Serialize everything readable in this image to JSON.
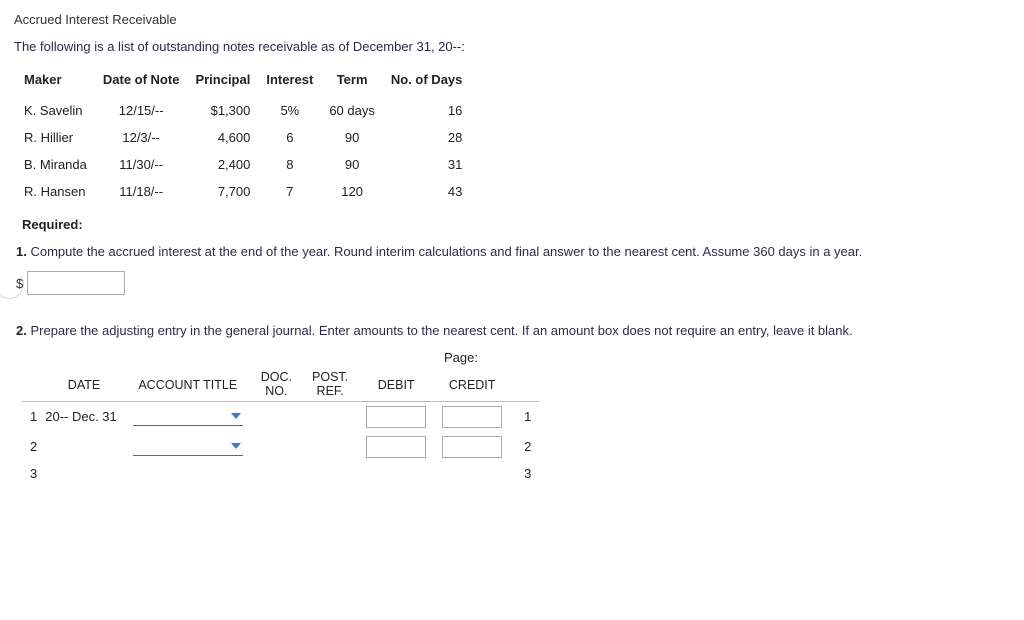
{
  "title": "Accrued Interest Receivable",
  "intro": "The following is a list of outstanding notes receivable as of December 31, 20--:",
  "notesTable": {
    "headers": {
      "maker": "Maker",
      "date": "Date of Note",
      "principal": "Principal",
      "interest": "Interest",
      "term": "Term",
      "days": "No. of Days"
    },
    "rows": [
      {
        "maker": "K. Savelin",
        "date": "12/15/--",
        "principal": "$1,300",
        "interest": "5%",
        "term": "60 days",
        "days": "16"
      },
      {
        "maker": "R. Hillier",
        "date": "12/3/--",
        "principal": "4,600",
        "interest": "6",
        "term": "90",
        "days": "28"
      },
      {
        "maker": "B. Miranda",
        "date": "11/30/--",
        "principal": "2,400",
        "interest": "8",
        "term": "90",
        "days": "31"
      },
      {
        "maker": "R. Hansen",
        "date": "11/18/--",
        "principal": "7,700",
        "interest": "7",
        "term": "120",
        "days": "43"
      }
    ]
  },
  "requiredLabel": "Required:",
  "q1": {
    "num": "1.",
    "text": "Compute the accrued interest at the end of the year. Round interim calculations and final answer to the nearest cent. Assume 360 days in a year."
  },
  "currency": "$",
  "q2": {
    "num": "2.",
    "text": "Prepare the adjusting entry in the general journal. Enter amounts to the nearest cent. If an amount box does not require an entry, leave it blank."
  },
  "journal": {
    "pageLabel": "Page:",
    "headers": {
      "date": "DATE",
      "account": "ACCOUNT TITLE",
      "docno": "DOC.\nNO.",
      "postref": "POST.\nREF.",
      "debit": "DEBIT",
      "credit": "CREDIT"
    },
    "rows": [
      {
        "n": "1",
        "date": "20-- Dec. 31",
        "side": "1"
      },
      {
        "n": "2",
        "date": "",
        "side": "2"
      },
      {
        "n": "3",
        "date": "",
        "side": "3"
      }
    ]
  }
}
